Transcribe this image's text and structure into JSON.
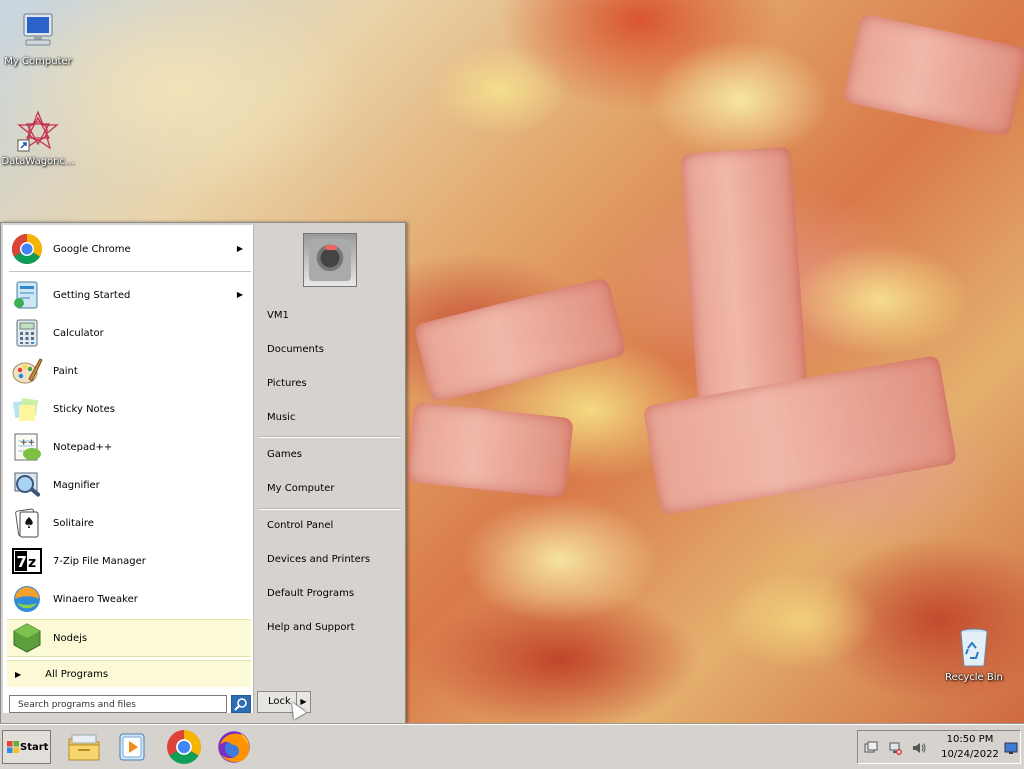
{
  "desktop": {
    "icons": [
      {
        "label": "My Computer"
      },
      {
        "label": "DataWagonc..."
      },
      {
        "label": "Recycle Bin"
      }
    ]
  },
  "start_menu": {
    "pinned": [
      {
        "label": "Google Chrome",
        "has_submenu": true
      }
    ],
    "programs": [
      {
        "label": "Getting Started",
        "has_submenu": true
      },
      {
        "label": "Calculator"
      },
      {
        "label": "Paint"
      },
      {
        "label": "Sticky Notes"
      },
      {
        "label": "Notepad++"
      },
      {
        "label": "Magnifier"
      },
      {
        "label": "Solitaire"
      },
      {
        "label": "7-Zip File Manager"
      },
      {
        "label": "Winaero Tweaker"
      },
      {
        "label": "Nodejs"
      }
    ],
    "all_programs": "All Programs",
    "search_placeholder": "Search programs and files",
    "places": [
      {
        "label": "VM1"
      },
      {
        "label": "Documents"
      },
      {
        "label": "Pictures"
      },
      {
        "label": "Music"
      },
      {
        "label": "Games"
      },
      {
        "label": "My Computer"
      },
      {
        "label": "Control Panel"
      },
      {
        "label": "Devices and Printers"
      },
      {
        "label": "Default Programs"
      },
      {
        "label": "Help and Support"
      }
    ],
    "lock_label": "Lock"
  },
  "taskbar": {
    "start_label": "Start",
    "apps": [
      "file-explorer-icon",
      "media-player-icon",
      "chrome-icon",
      "firefox-icon"
    ],
    "clock": {
      "time": "10:50 PM",
      "date": "10/24/2022"
    }
  },
  "colors": {
    "menu_bg": "#d6d3ce",
    "highlight": "#fbf9d6",
    "search_button": "#2f6db3"
  }
}
